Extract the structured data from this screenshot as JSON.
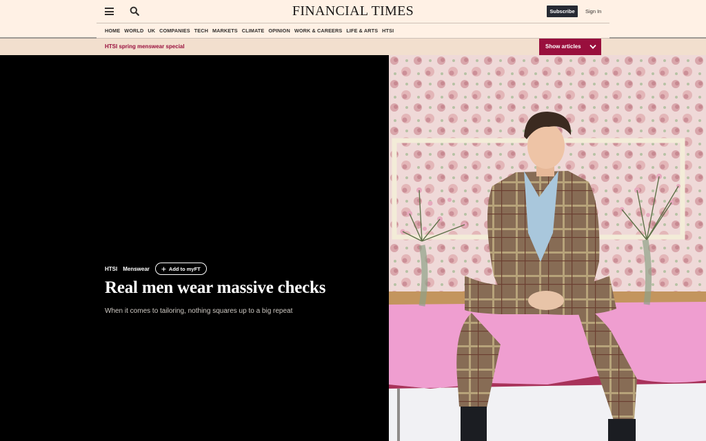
{
  "header": {
    "logo": "FINANCIAL TIMES",
    "subscribe_label": "Subscribe",
    "signin_label": "Sign In"
  },
  "nav": {
    "items": [
      "HOME",
      "WORLD",
      "UK",
      "COMPANIES",
      "TECH",
      "MARKETS",
      "CLIMATE",
      "OPINION",
      "WORK & CAREERS",
      "LIFE & ARTS",
      "HTSI"
    ]
  },
  "banner": {
    "title": "HTSI spring menswear special",
    "button_label": "Show articles"
  },
  "article": {
    "tags": [
      "HTSI",
      "Menswear"
    ],
    "myft_label": "Add to myFT",
    "headline": "Real men wear massive checks",
    "standfirst": "When it comes to tailoring, nothing squares up to a big repeat"
  },
  "icons": {
    "menu": "hamburger-menu-icon",
    "search": "search-icon",
    "chevron": "chevron-down-icon",
    "plus": "plus-icon"
  },
  "colors": {
    "background": "#fff1e5",
    "claret": "#990f3d",
    "banner_bg": "#f2dfce",
    "subscribe_bg": "#262a33"
  }
}
